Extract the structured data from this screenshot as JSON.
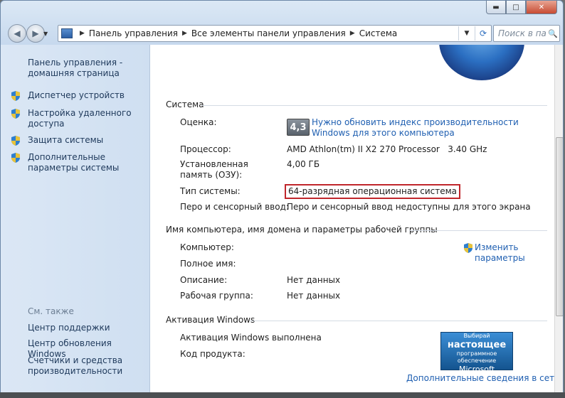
{
  "window": {
    "caption_buttons": {
      "minimize": "▬",
      "maximize": "□",
      "close": "✕"
    }
  },
  "nav": {
    "back_icon": "◀",
    "forward_icon": "▶",
    "dropdown_icon": "▼",
    "breadcrumb": [
      "Панель управления",
      "Все элементы панели управления",
      "Система"
    ],
    "crumb_separator": "▶",
    "refresh_icon": "⟳",
    "search_placeholder": "Поиск в пан...",
    "search_icon": "🔍"
  },
  "sidebar": {
    "home": "Панель управления - домашняя страница",
    "tasks": [
      "Диспетчер устройств",
      "Настройка удаленного доступа",
      "Защита системы",
      "Дополнительные параметры системы"
    ],
    "see_also_title": "См. также",
    "see_also": [
      "Центр поддержки",
      "Центр обновления Windows",
      "Счетчики и средства производительности"
    ]
  },
  "system": {
    "section_title": "Система",
    "rating_label": "Оценка:",
    "rating_badge": "4,3",
    "rating_link": "Нужно обновить индекс производительности Windows для этого компьютера",
    "processor_label": "Процессор:",
    "processor_value": "AMD Athlon(tm) II X2 270 Processor   3.40 GHz",
    "memory_label": "Установленная память (ОЗУ):",
    "memory_value": "4,00 ГБ",
    "type_label": "Тип системы:",
    "type_value": "64-разрядная операционная система",
    "pen_label": "Перо и сенсорный ввод:",
    "pen_value": "Перо и сенсорный ввод недоступны для этого экрана"
  },
  "computer": {
    "section_title": "Имя компьютера, имя домена и параметры рабочей группы",
    "computer_label": "Компьютер:",
    "computer_value": "",
    "fullname_label": "Полное имя:",
    "fullname_value": "",
    "description_label": "Описание:",
    "description_value": "Нет данных",
    "workgroup_label": "Рабочая группа:",
    "workgroup_value": "Нет данных",
    "change_link": "Изменить параметры"
  },
  "activation": {
    "section_title": "Активация Windows",
    "status": "Активация Windows выполнена",
    "product_key_label": "Код продукта:",
    "product_key_value": "",
    "badge_line1": "Выбирай",
    "badge_line2": "настоящее",
    "badge_line3": "программное обеспечение",
    "badge_line4": "Microsoft",
    "more_link": "Дополнительные сведения в сети..."
  }
}
